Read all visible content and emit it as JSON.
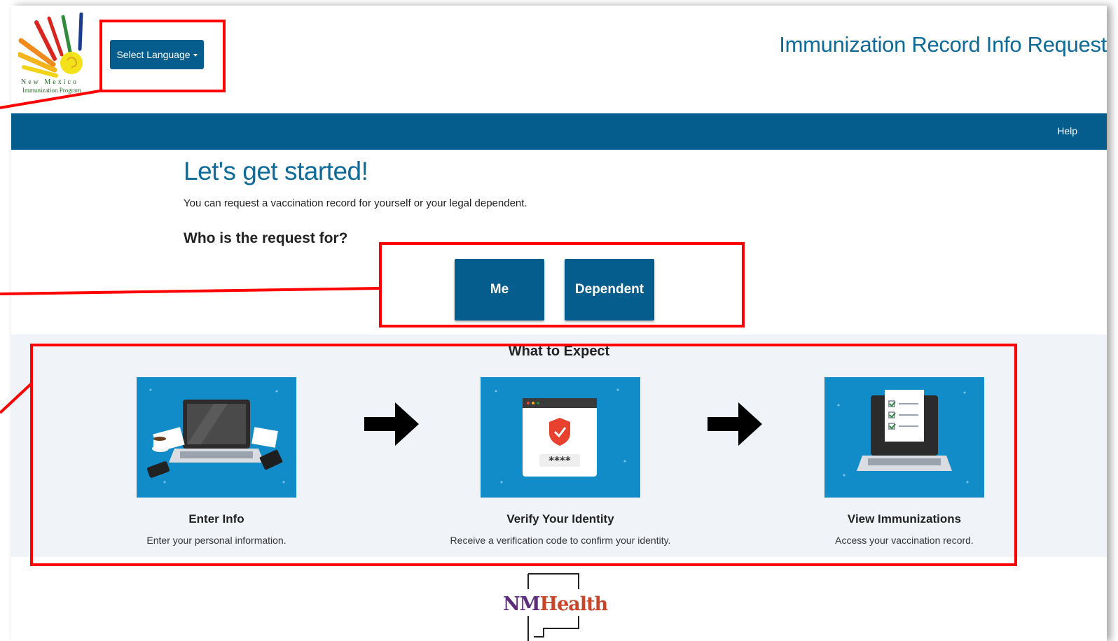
{
  "header": {
    "logo_line1": "New Mexico",
    "logo_line2": "Immunization Program",
    "language_button": "Select Language",
    "app_title": "Immunization Record Info Request"
  },
  "navbar": {
    "help": "Help"
  },
  "main": {
    "headline": "Let's get started!",
    "subtext": "You can request a vaccination record for yourself or your legal dependent.",
    "question": "Who is the request for?",
    "buttons": {
      "me": "Me",
      "dependent": "Dependent"
    }
  },
  "expect": {
    "title": "What to Expect",
    "steps": [
      {
        "title": "Enter Info",
        "desc": "Enter your personal information.",
        "icon": "laptop-desk-icon"
      },
      {
        "title": "Verify Your Identity",
        "desc": "Receive a verification code to confirm your identity.",
        "icon": "verification-shield-icon"
      },
      {
        "title": "View Immunizations",
        "desc": "Access your vaccination record.",
        "icon": "laptop-checklist-icon"
      }
    ]
  },
  "footer": {
    "logo_nm": "NM",
    "logo_health": "Health"
  },
  "colors": {
    "primary": "#045d8c",
    "title": "#0e6a98",
    "annotation": "#ff0000",
    "step_bg": "#118cc8"
  }
}
